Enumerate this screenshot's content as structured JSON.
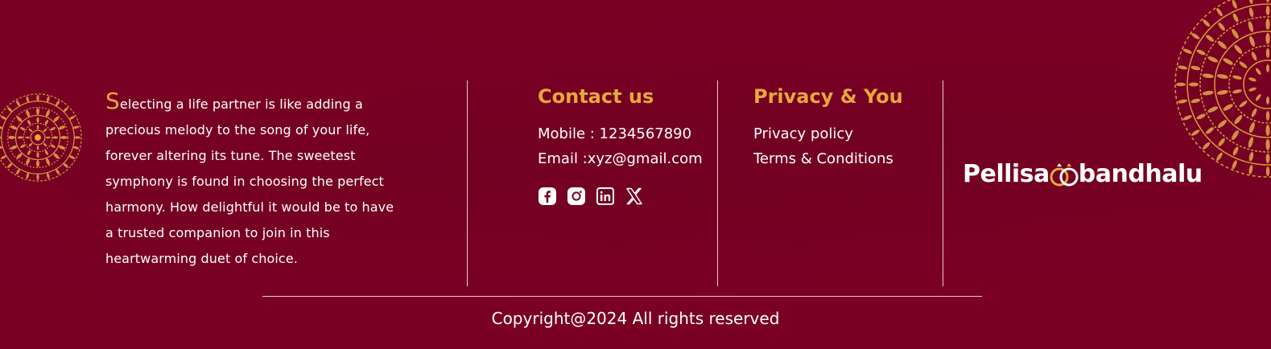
{
  "about": {
    "dropcap": "S",
    "text": "electing a life partner is like adding a precious melody to the song of your life, forever altering its tune. The sweetest symphony is found in choosing the perfect harmony. How delightful it would be to have a trusted companion to join in this heartwarming duet of choice."
  },
  "contact": {
    "title": "Contact us",
    "mobile": "Mobile : 1234567890",
    "email": "Email :xyz@gmail.com",
    "social_icons": [
      "facebook-icon",
      "instagram-icon",
      "linkedin-icon",
      "x-twitter-icon"
    ]
  },
  "privacy": {
    "title": "Privacy & You",
    "links": [
      "Privacy policy",
      "Terms & Conditions"
    ]
  },
  "logo": {
    "part1": "Pellisa",
    "part2": "bandhalu"
  },
  "footer": {
    "copyright": "Copyright@2024 All rights reserved"
  },
  "colors": {
    "background": "#7a0024",
    "accent": "#e8a73c",
    "text": "#ffffff",
    "divider": "#e9c7cf"
  }
}
